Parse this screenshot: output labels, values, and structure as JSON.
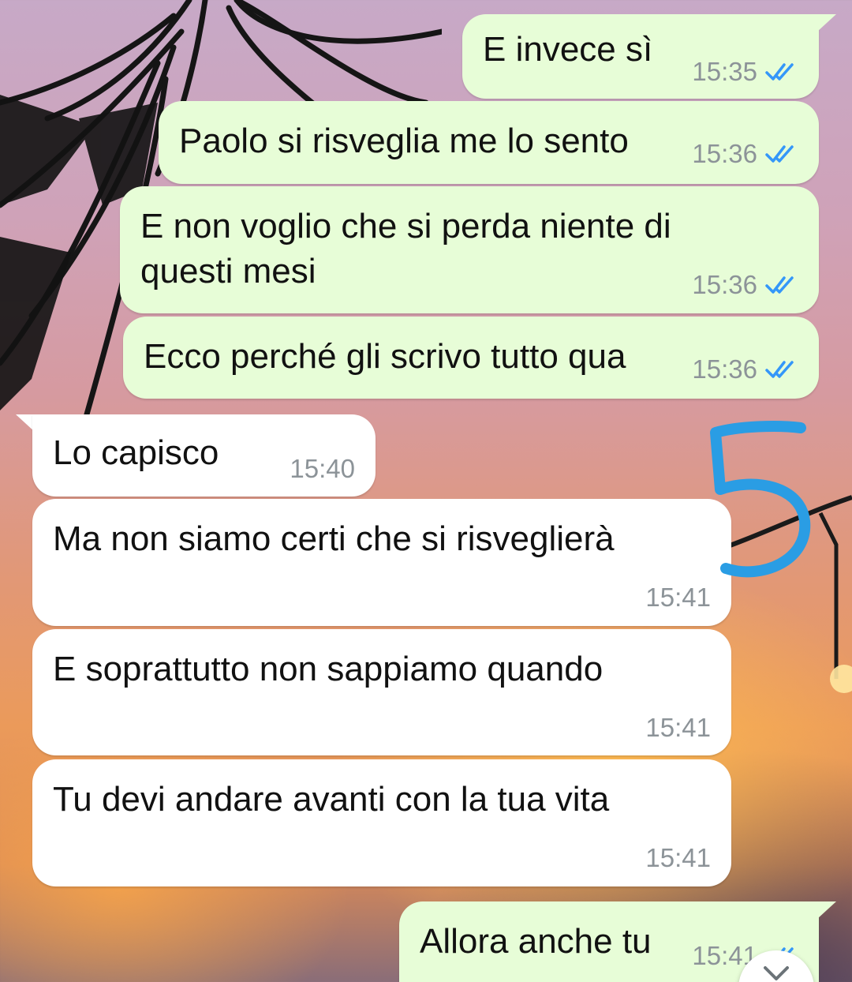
{
  "chat": {
    "messages": [
      {
        "direction": "out",
        "text": "E invece sì",
        "time": "15:35",
        "status": "read"
      },
      {
        "direction": "out",
        "text": "Paolo si risveglia me lo sento",
        "time": "15:36",
        "status": "read"
      },
      {
        "direction": "out",
        "text": "E non voglio che si perda niente di\nquesti mesi",
        "time": "15:36",
        "status": "read"
      },
      {
        "direction": "out",
        "text": "Ecco perché gli scrivo tutto qua",
        "time": "15:36",
        "status": "read"
      },
      {
        "direction": "in",
        "text": "Lo capisco",
        "time": "15:40"
      },
      {
        "direction": "in",
        "text": "Ma non siamo certi che si risveglierà",
        "time": "15:41"
      },
      {
        "direction": "in",
        "text": "E soprattutto non sappiamo quando",
        "time": "15:41"
      },
      {
        "direction": "in",
        "text": "Tu devi andare avanti con la tua vita",
        "time": "15:41"
      },
      {
        "direction": "out",
        "text": "Allora anche tu",
        "time": "15:41",
        "status": "read"
      }
    ]
  },
  "annotation": {
    "digit": "5",
    "color": "#2a9de4"
  },
  "icons": {
    "read_receipt": "double-check-icon",
    "scroll_down": "chevron-down-icon"
  },
  "colors": {
    "outgoing_bubble": "#e7fdd7",
    "incoming_bubble": "#ffffff",
    "timestamp": "#8c9398",
    "read_tick": "#3497f9"
  }
}
